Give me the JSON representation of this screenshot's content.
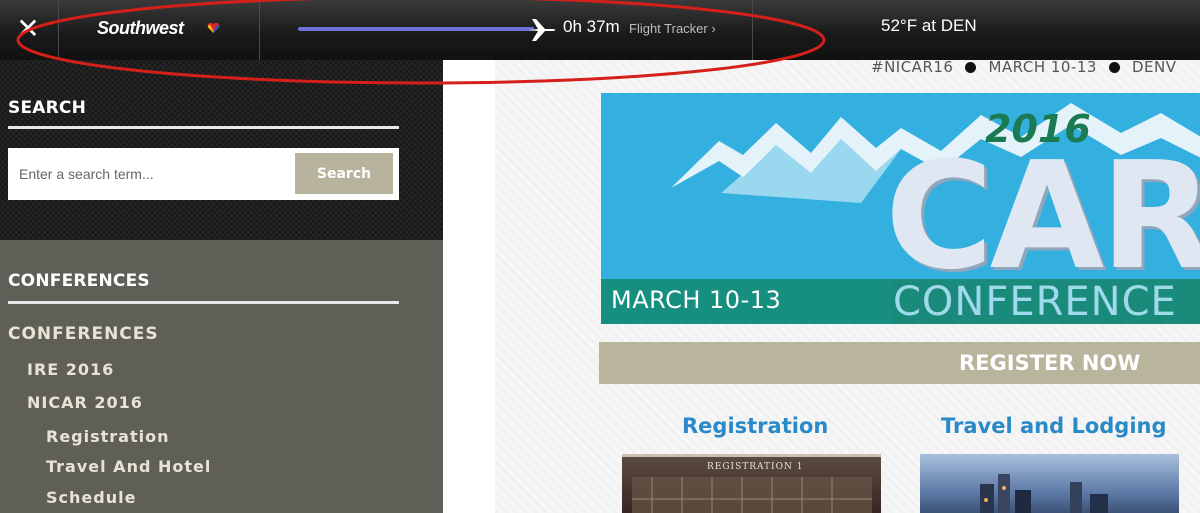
{
  "topbar": {
    "close_label": "✕",
    "brand": "Southwest",
    "flight_time": "0h 37m",
    "flight_tracker_label": "Flight Tracker",
    "weather": "52°F at DEN",
    "flight_progress_fraction": 0.95,
    "colors": {
      "progress": "#6b73d8",
      "annotation": "#d4201a"
    }
  },
  "sidebar": {
    "search_heading": "SEARCH",
    "search_placeholder": "Enter a search term...",
    "search_button": "Search",
    "conferences_heading": "CONFERENCES",
    "nav": [
      {
        "label": "CONFERENCES",
        "level": 0
      },
      {
        "label": "IRE 2016",
        "level": 1
      },
      {
        "label": "NICAR 2016",
        "level": 1
      },
      {
        "label": "Registration",
        "level": 2
      },
      {
        "label": "Travel And Hotel",
        "level": 2
      },
      {
        "label": "Schedule",
        "level": 2
      }
    ]
  },
  "main": {
    "tagline": {
      "hashtag": "#NICAR16",
      "dates": "MARCH 10-13",
      "location": "DENV"
    },
    "banner": {
      "dates": "MARCH 10-13",
      "year": "2016",
      "title": "CAR",
      "subtitle": "CONFERENCE"
    },
    "register_label": "REGISTER NOW",
    "columns": [
      {
        "title": "Registration",
        "image_caption": "REGISTRATION 1"
      },
      {
        "title": "Travel and Lodging"
      }
    ]
  }
}
